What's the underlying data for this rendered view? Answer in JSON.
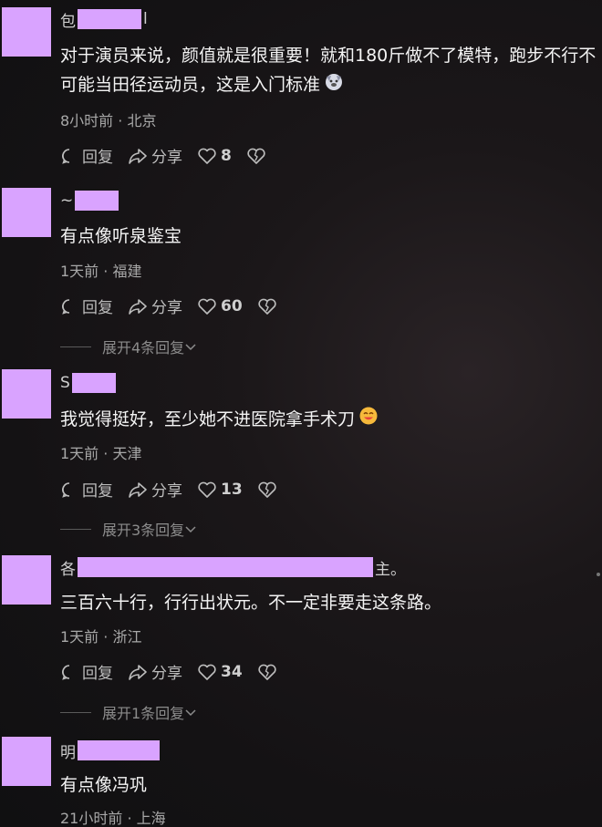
{
  "actions_labels": {
    "reply": "回复",
    "share": "分享"
  },
  "comments": [
    {
      "username_prefix": "包",
      "username_suffix": "l",
      "content": "对于演员来说，颜值就是很重要！就和180斤做不了模特，跑步不行不可能当田径运动员，这是入门标准",
      "meta": "8小时前 · 北京",
      "likes": "8",
      "emoji": "dog-face-emoji"
    },
    {
      "username_prefix": "~",
      "username_suffix": "",
      "content": "有点像听泉鉴宝",
      "meta": "1天前 · 福建",
      "likes": "60",
      "expand": "展开4条回复"
    },
    {
      "username_prefix": "S",
      "username_suffix": "",
      "content": "我觉得挺好，至少她不进医院拿手术刀",
      "meta": "1天前 · 天津",
      "likes": "13",
      "expand": "展开3条回复",
      "emoji": "smiling-face-emoji"
    },
    {
      "username_prefix": "各",
      "username_suffix": "主。",
      "content": "三百六十行，行行出状元。不一定非要走这条路。",
      "meta": "1天前 · 浙江",
      "likes": "34",
      "expand": "展开1条回复"
    },
    {
      "username_prefix": "明",
      "username_suffix": "",
      "content": "有点像冯巩",
      "meta": "21小时前 · 上海"
    }
  ],
  "colors": {
    "redaction": "#d9a3ff",
    "text": "#f4f4f4",
    "meta": "#a8a8a8",
    "action": "#bdbdbd"
  }
}
